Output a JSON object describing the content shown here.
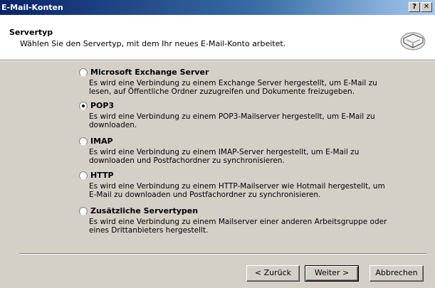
{
  "window": {
    "title": "E-Mail-Konten",
    "help_label": "?",
    "close_label": "✕"
  },
  "header": {
    "title": "Servertyp",
    "subtitle": "Wählen Sie den Servertyp, mit dem Ihr neues E-Mail-Konto arbeitet."
  },
  "options": [
    {
      "label": "Microsoft Exchange Server",
      "selected": false,
      "desc": "Es wird eine Verbindung zu einem Exchange Server hergestellt, um E-Mail zu lesen, auf Öffentliche Ordner zuzugreifen und Dokumente freizugeben."
    },
    {
      "label": "POP3",
      "selected": true,
      "desc": "Es wird eine Verbindung zu einem POP3-Mailserver hergestellt, um E-Mail zu downloaden."
    },
    {
      "label": "IMAP",
      "selected": false,
      "desc": "Es wird eine Verbindung zu einem IMAP-Server hergestellt, um E-Mail zu downloaden und Postfachordner zu synchronisieren."
    },
    {
      "label": "HTTP",
      "selected": false,
      "desc": "Es wird eine Verbindung zu einem HTTP-Mailserver wie Hotmail hergestellt, um E-Mail zu downloaden und Postfachordner zu synchronisieren."
    },
    {
      "label": "Zusätzliche Servertypen",
      "selected": false,
      "desc": "Es wird eine Verbindung zu einem Mailserver einer anderen Arbeitsgruppe oder eines Drittanbieters hergestellt."
    }
  ],
  "buttons": {
    "back": "< Zurück",
    "next": "Weiter >",
    "cancel": "Abbrechen"
  },
  "colors": {
    "background": "#ccffcc",
    "titlebar": "#0a246a",
    "dialog": "#d4d0c8"
  },
  "icons": {
    "header": "mail-server-icon"
  }
}
